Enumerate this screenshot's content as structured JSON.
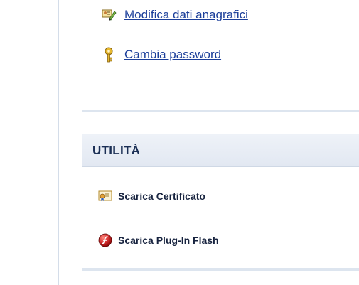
{
  "account_links": [
    {
      "label": "Modifica dati anagrafici",
      "icon": "edit-user-data-icon"
    },
    {
      "label": "Cambia password",
      "icon": "key-icon"
    }
  ],
  "utilities": {
    "title": "UTILITÀ",
    "items": [
      {
        "label": "Scarica Certificato",
        "icon": "certificate-icon"
      },
      {
        "label": "Scarica Plug-In Flash",
        "icon": "flash-plugin-icon"
      }
    ]
  },
  "colors": {
    "link": "#1c3f9a",
    "panel_border": "#c9d4e2",
    "header_bg": "#e6ebf3",
    "header_text": "#1b2f55"
  }
}
